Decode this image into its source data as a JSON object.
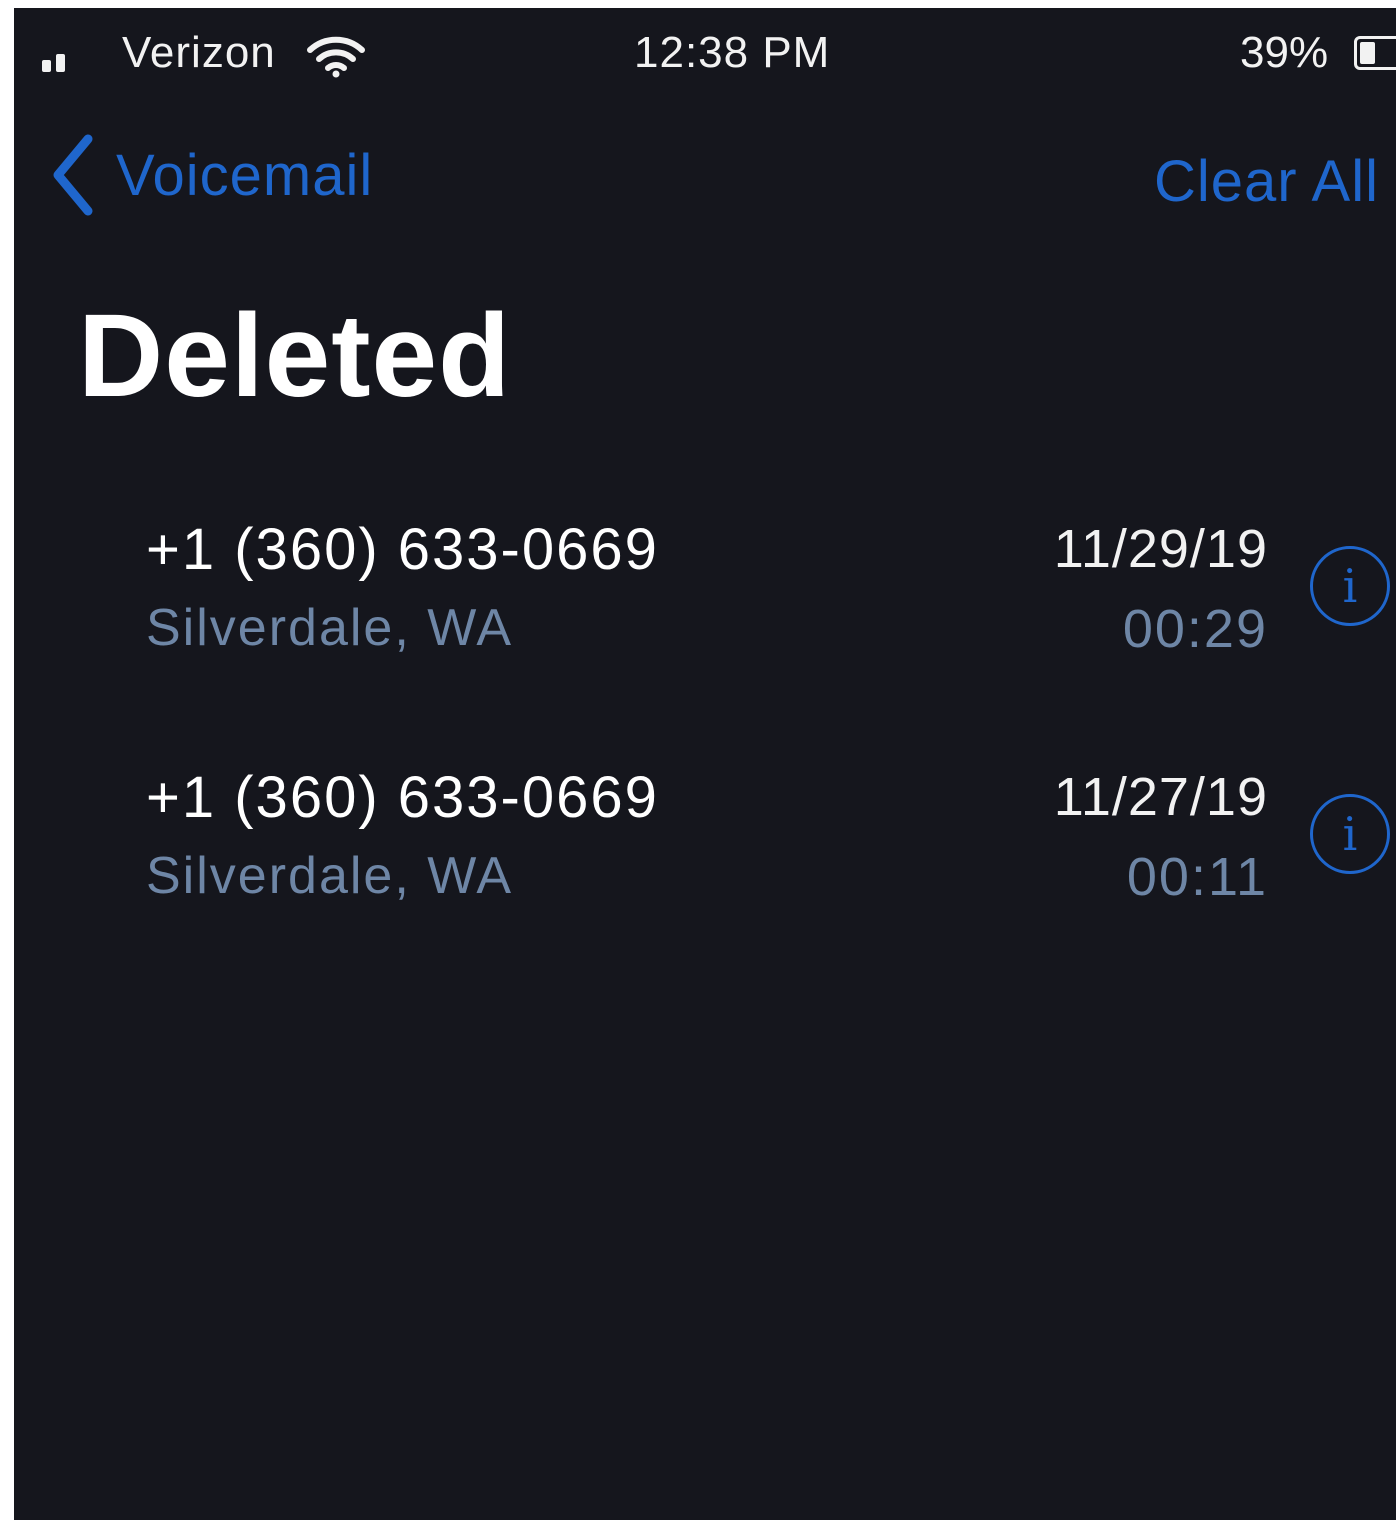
{
  "status_bar": {
    "carrier": "Verizon",
    "time": "12:38 PM",
    "battery_percent": "39%",
    "battery_level": 0.39,
    "icons": {
      "signal": "cellular-signal-icon",
      "wifi": "wifi-icon",
      "battery": "battery-icon"
    }
  },
  "nav": {
    "back_label": "Voicemail",
    "back_icon": "chevron-left-icon",
    "clear_all_label": "Clear All"
  },
  "page": {
    "title": "Deleted"
  },
  "colors": {
    "background": "#15161d",
    "accent": "#1f66cc",
    "primary_text": "#ffffff",
    "secondary_text": "#6e86a6"
  },
  "voicemails": [
    {
      "number": "+1 (360) 633-0669",
      "location": "Silverdale, WA",
      "date": "11/29/19",
      "duration": "00:29",
      "info_icon": "info-icon"
    },
    {
      "number": "+1 (360) 633-0669",
      "location": "Silverdale, WA",
      "date": "11/27/19",
      "duration": "00:11",
      "info_icon": "info-icon"
    }
  ]
}
